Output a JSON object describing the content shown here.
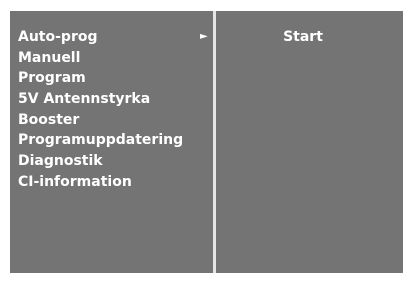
{
  "menu": {
    "items": [
      {
        "label": "Auto-prog",
        "has_submenu": true
      },
      {
        "label": "Manuell"
      },
      {
        "label": "Program"
      },
      {
        "label": "5V Antennstyrka"
      },
      {
        "label": "Booster"
      },
      {
        "label": "Programuppdatering"
      },
      {
        "label": "Diagnostik"
      },
      {
        "label": "CI-information"
      }
    ],
    "submenu_arrow": "►"
  },
  "submenu": {
    "start_label": "Start"
  },
  "icons": {
    "submenu_arrow": "right-triangle-icon"
  },
  "colors": {
    "panel_background": "#747474",
    "text": "#ffffff",
    "divider": "#e6e6e6"
  }
}
